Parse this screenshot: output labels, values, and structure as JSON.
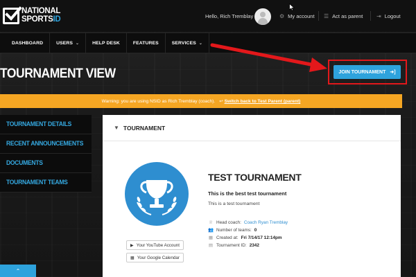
{
  "brand": {
    "line1": "NATIONAL",
    "line2a": "SPORTS",
    "line2b": "ID"
  },
  "header": {
    "greeting": "Hello, Rich Tremblay",
    "my_account": "My account",
    "act_as_parent": "Act as parent",
    "logout": "Logout"
  },
  "nav": {
    "items": [
      {
        "label": "DASHBOARD"
      },
      {
        "label": "USERS"
      },
      {
        "label": "HELP DESK"
      },
      {
        "label": "FEATURES"
      },
      {
        "label": "SERVICES"
      }
    ]
  },
  "page": {
    "title": "TOURNAMENT VIEW",
    "join_button": "JOIN TOURNAMENT"
  },
  "warning": {
    "text": "Warning: you are using NSID as Rich Tremblay (coach).",
    "link": "Switch back to Test Parent (parent)"
  },
  "sidebar": {
    "items": [
      {
        "label": "TOURNAMENT DETAILS"
      },
      {
        "label": "RECENT ANNOUNCEMENTS"
      },
      {
        "label": "DOCUMENTS"
      },
      {
        "label": "TOURNAMENT TEAMS"
      }
    ]
  },
  "panel": {
    "header": "TOURNAMENT",
    "name": "TEST TOURNAMENT",
    "tagline": "This is the best test tournament",
    "description": "This is a test tournament",
    "youtube": "Your YouTube Account",
    "gcal": "Your Google Calendar",
    "head_coach_label": "Head coach:",
    "head_coach_value": "Coach Ryan Tremblay",
    "teams_label": "Number of teams:",
    "teams_value": "0",
    "created_label": "Created at:",
    "created_value": "Fri 7/14/17 12:14pm",
    "id_label": "Tournament ID:",
    "id_value": "2342"
  },
  "colors": {
    "accent": "#2ea3dd",
    "warning": "#f5a623",
    "highlight": "#e3181b"
  }
}
